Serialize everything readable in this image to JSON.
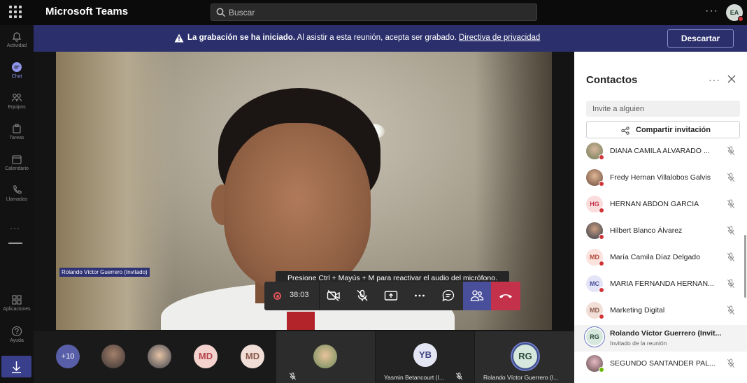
{
  "topbar": {
    "app_title": "Microsoft Teams",
    "search_placeholder": "Buscar",
    "user_initials": "EA"
  },
  "rail": {
    "items": [
      {
        "label": "Actividad",
        "icon": "bell-icon"
      },
      {
        "label": "Chat",
        "icon": "chat-icon"
      },
      {
        "label": "Equipos",
        "icon": "teams-icon"
      },
      {
        "label": "Tareas",
        "icon": "tasks-icon"
      },
      {
        "label": "Calendario",
        "icon": "calendar-icon"
      },
      {
        "label": "Llamadas",
        "icon": "phone-icon"
      },
      {
        "label": "Aplicaciones",
        "icon": "apps-icon"
      },
      {
        "label": "Ayuda",
        "icon": "help-icon"
      }
    ]
  },
  "banner": {
    "bold_text": "La grabación se ha iniciado.",
    "text": " Al asistir a esta reunión, acepta ser grabado. ",
    "link": "Directiva de privacidad",
    "dismiss_label": "Descartar"
  },
  "video": {
    "speaker_tag": "Rolando Víctor Guerrero (Invitado)"
  },
  "call": {
    "tooltip": "Presione Ctrl + Mayús + M para reactivar el audio del micrófono.",
    "timer": "38:03"
  },
  "gallery": {
    "more_count": "+10",
    "tiles": [
      {
        "initials": "MD"
      },
      {
        "initials": "MD"
      },
      {
        "initials": "YB",
        "name": "Yasmin Betancourt (I..."
      },
      {
        "initials": "RG",
        "name": "Rolando Víctor Guerrero (I..."
      }
    ]
  },
  "panel": {
    "title": "Contactos",
    "invite_placeholder": "Invite a alguien",
    "share_label": "Compartir invitación",
    "contacts": [
      {
        "name": "DIANA CAMILA ALVARADO ...",
        "initials": ""
      },
      {
        "name": "Fredy Hernan Villalobos Galvis",
        "initials": ""
      },
      {
        "name": "HERNAN ABDON GARCIA",
        "initials": "HG"
      },
      {
        "name": "Hilbert Blanco Álvarez",
        "initials": ""
      },
      {
        "name": "María Camila Díaz Delgado",
        "initials": "MD"
      },
      {
        "name": "MARIA FERNANDA HERNAN...",
        "initials": "MC"
      },
      {
        "name": "Marketing Digital",
        "initials": "MD"
      },
      {
        "name": "Rolando Víctor Guerrero (Invit...",
        "initials": "RG",
        "subtitle": "Invitado de la reunión"
      },
      {
        "name": "SEGUNDO SANTANDER PAL...",
        "initials": ""
      }
    ]
  },
  "colors": {
    "accent": "#4a4f9c",
    "banner": "#2b2f6b",
    "hangup": "#c4314b",
    "busy": "#d13438",
    "available": "#6bb700"
  }
}
